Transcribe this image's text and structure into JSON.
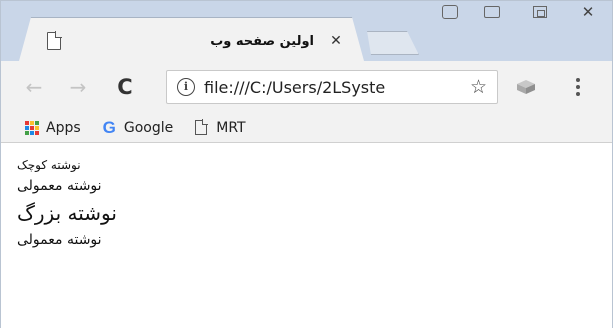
{
  "window": {
    "controls": [
      "minimize",
      "maximize",
      "close"
    ]
  },
  "tab": {
    "title": "اولین صفحه وب",
    "close_glyph": "✕",
    "icon": "page-icon"
  },
  "toolbar": {
    "back_glyph": "←",
    "forward_glyph": "→",
    "reload_glyph": "C",
    "info_glyph": "i",
    "url": "file:///C:/Users/2LSyste",
    "star_glyph": "☆"
  },
  "bookmarks": {
    "items": [
      {
        "label": "Apps",
        "icon": "apps-grid-icon"
      },
      {
        "label": "Google",
        "icon": "google-g-icon"
      },
      {
        "label": "MRT",
        "icon": "page-icon"
      }
    ]
  },
  "content": {
    "lines": [
      {
        "text": "نوشته کوچک",
        "size": "small"
      },
      {
        "text": "نوشته معمولی",
        "size": "normal"
      },
      {
        "text": "نوشته بزرگ",
        "size": "large"
      },
      {
        "text": "نوشته معمولی",
        "size": "normal"
      }
    ]
  },
  "colors": {
    "titlebar": "#c9d6e8",
    "toolbar": "#f2f2f2",
    "google_blue": "#4285f4"
  }
}
